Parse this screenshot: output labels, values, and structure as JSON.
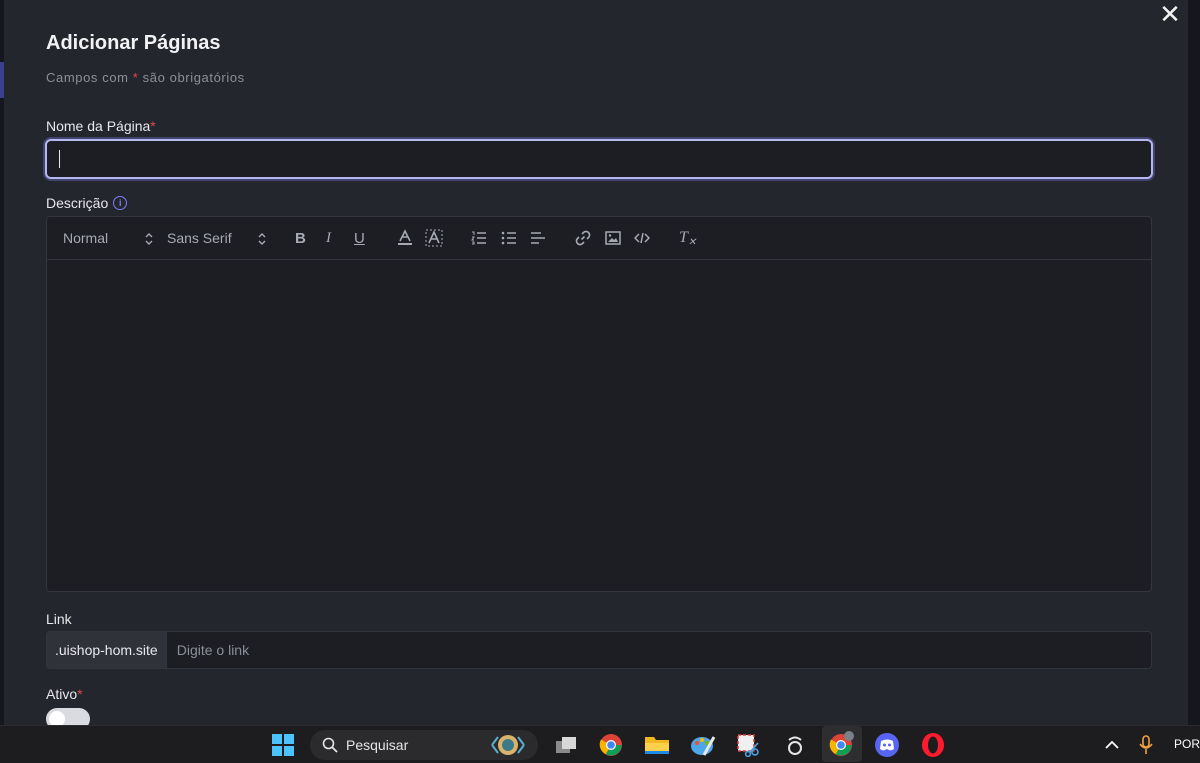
{
  "modal": {
    "title": "Adicionar Páginas",
    "subtitle_prefix": "Campos com ",
    "subtitle_star": "*",
    "subtitle_suffix": " são obrigatórios",
    "close_glyph": "✕"
  },
  "fields": {
    "name": {
      "label": "Nome da Página",
      "required_mark": "*",
      "value": ""
    },
    "description": {
      "label": "Descrição",
      "info_glyph": "i",
      "toolbar": {
        "size_select": "Normal",
        "font_select": "Sans Serif",
        "bold": "B",
        "italic": "I",
        "underline": "U",
        "clear_format": "T"
      }
    },
    "link": {
      "label": "Link",
      "prefix": ".uishop-hom.site",
      "placeholder": "Digite o link"
    },
    "active": {
      "label": "Ativo",
      "required_mark": "*",
      "toggled": false
    }
  },
  "taskbar": {
    "search_placeholder": "Pesquisar",
    "language": "POR",
    "icons": [
      "windows-start-icon",
      "search-icon",
      "task-view-icon",
      "chrome-icon",
      "file-explorer-icon",
      "paint-icon",
      "snipping-tool-icon",
      "app-icon",
      "chrome-profile-icon",
      "discord-icon",
      "opera-icon",
      "chevron-up-icon",
      "microphone-icon"
    ]
  }
}
